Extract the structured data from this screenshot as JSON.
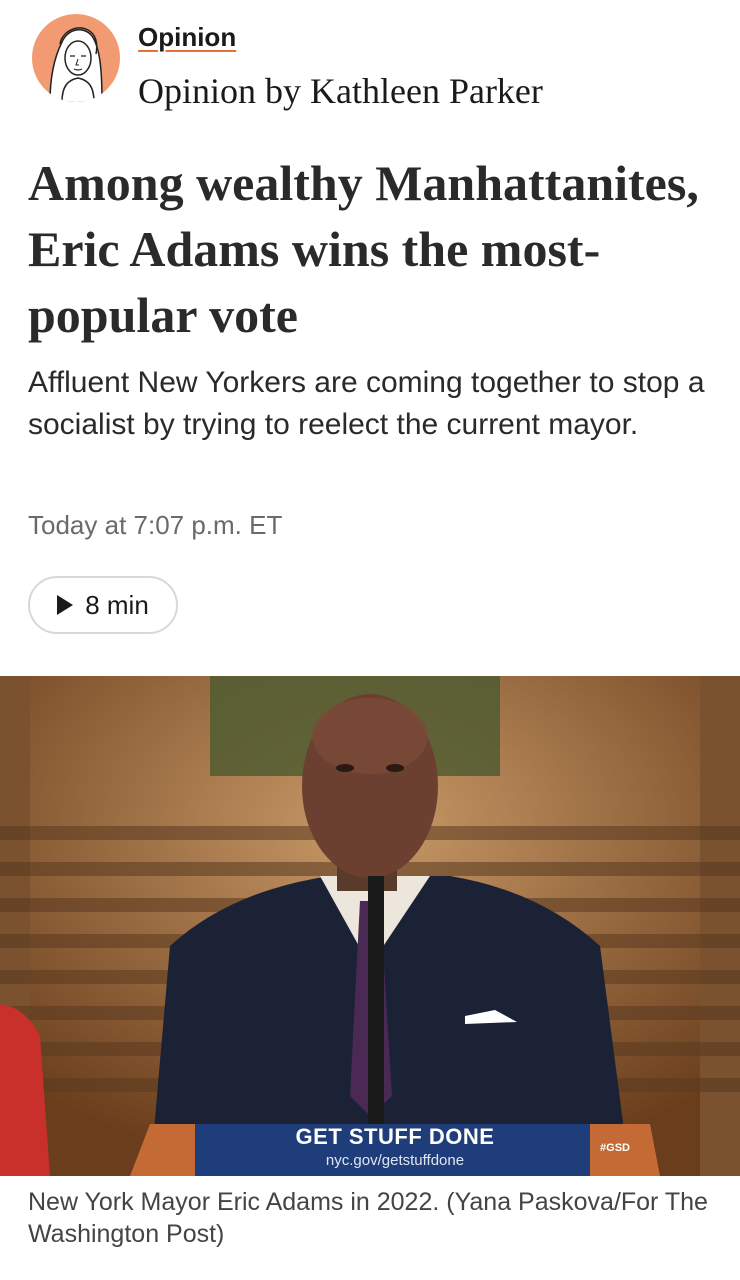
{
  "byline": {
    "section_label": "Opinion",
    "author_line": "Opinion by Kathleen Parker"
  },
  "article": {
    "headline": "Among wealthy Manhattanites, Eric Adams wins the most-popular vote",
    "deck": "Affluent New Yorkers are coming together to stop a socialist by trying to reelect the current mayor.",
    "timestamp": "Today at 7:07 p.m. ET"
  },
  "listen": {
    "icon": "play-icon",
    "label": "8 min"
  },
  "photo": {
    "podium_text": "GET STUFF DONE",
    "podium_url": "nyc.gov/getstuffdone",
    "podium_tag": "#GSD",
    "caption": "New York Mayor Eric Adams in 2022. (Yana Paskova/For The Washington Post)"
  },
  "colors": {
    "accent": "#e8703a",
    "avatar_bg": "#f29a72",
    "text": "#2a2a2a",
    "muted": "#6a6a6a"
  }
}
